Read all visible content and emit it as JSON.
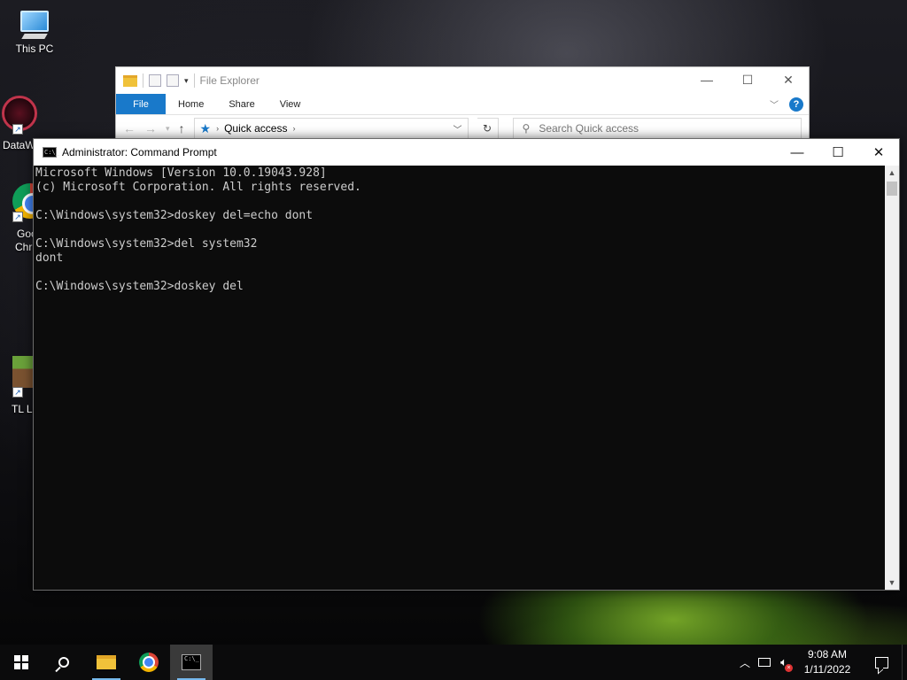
{
  "desktop": {
    "icons": [
      {
        "label": "This PC"
      },
      {
        "label": "DataW"
      },
      {
        "label": "Goo"
      },
      {
        "label": "Chr"
      },
      {
        "label": "TL Le"
      }
    ]
  },
  "explorer": {
    "title": "File Explorer",
    "ribbon_tabs": [
      "File",
      "Home",
      "Share",
      "View"
    ],
    "address": "Quick access",
    "search_placeholder": "Search Quick access",
    "help": "?"
  },
  "cmd": {
    "title": "Administrator: Command Prompt",
    "lines": [
      "Microsoft Windows [Version 10.0.19043.928]",
      "(c) Microsoft Corporation. All rights reserved.",
      "",
      "C:\\Windows\\system32>doskey del=echo dont",
      "",
      "C:\\Windows\\system32>del system32",
      "dont",
      "",
      "C:\\Windows\\system32>doskey del"
    ]
  },
  "taskbar": {
    "time": "9:08 AM",
    "date": "1/11/2022",
    "apps": [
      "start-icon",
      "search-icon",
      "file-explorer-icon",
      "chrome-icon",
      "command-prompt-icon"
    ]
  }
}
